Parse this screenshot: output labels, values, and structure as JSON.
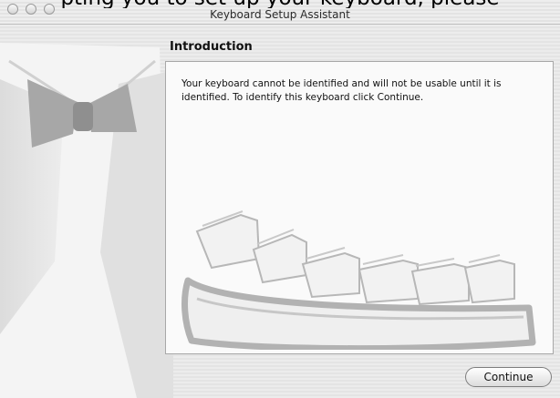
{
  "overlay_caption": "pting you to set up your keyboard, please",
  "window": {
    "title": "Keyboard Setup Assistant"
  },
  "section": {
    "title": "Introduction"
  },
  "panel": {
    "message": "Your keyboard cannot be identified and will not be usable until it is identified. To identify this keyboard click Continue."
  },
  "buttons": {
    "continue_label": "Continue"
  },
  "icons": [
    "close-icon",
    "minimize-icon",
    "zoom-icon",
    "tuxedo-illustration",
    "keyboard-illustration"
  ]
}
